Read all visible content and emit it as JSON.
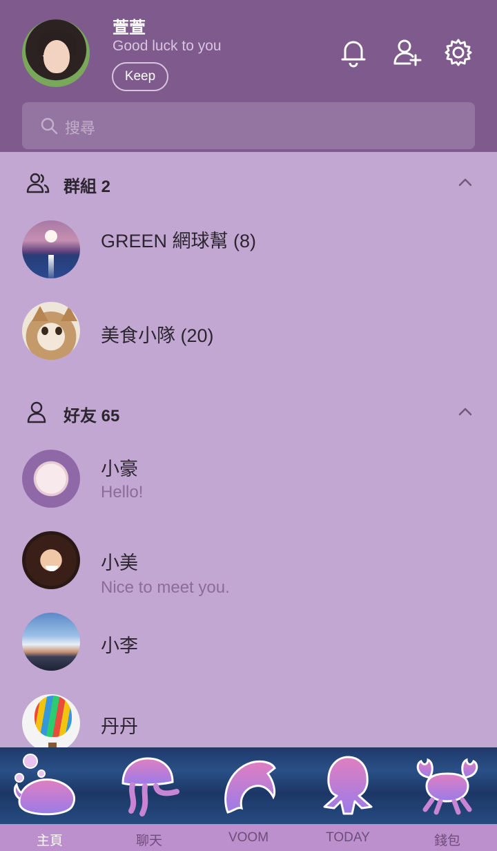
{
  "profile": {
    "name": "萱萱",
    "status": "Good luck to you",
    "keep_label": "Keep"
  },
  "header_icons": [
    "bell-icon",
    "add-friend-icon",
    "gear-icon"
  ],
  "search": {
    "placeholder": "搜尋"
  },
  "groups": {
    "title": "群組 2",
    "items": [
      {
        "name": "GREEN 網球幫 (8)"
      },
      {
        "name": "美食小隊 (20)"
      }
    ]
  },
  "friends": {
    "title": "好友 65",
    "items": [
      {
        "name": "小豪",
        "message": "Hello!"
      },
      {
        "name": "小美",
        "message": "Nice to meet you."
      },
      {
        "name": "小李"
      },
      {
        "name": "丹丹"
      }
    ]
  },
  "tabs": [
    {
      "label": "主頁",
      "icon": "whale-icon",
      "active": true
    },
    {
      "label": "聊天",
      "icon": "jellyfish-icon",
      "active": false
    },
    {
      "label": "VOOM",
      "icon": "dolphin-icon",
      "active": false
    },
    {
      "label": "TODAY",
      "icon": "octopus-icon",
      "active": false
    },
    {
      "label": "錢包",
      "icon": "crab-icon",
      "active": false
    }
  ],
  "colors": {
    "header_bg": "#7f5a8c",
    "list_bg": "#c1a7d1",
    "tabbar_bg": "#bc8fcd"
  }
}
